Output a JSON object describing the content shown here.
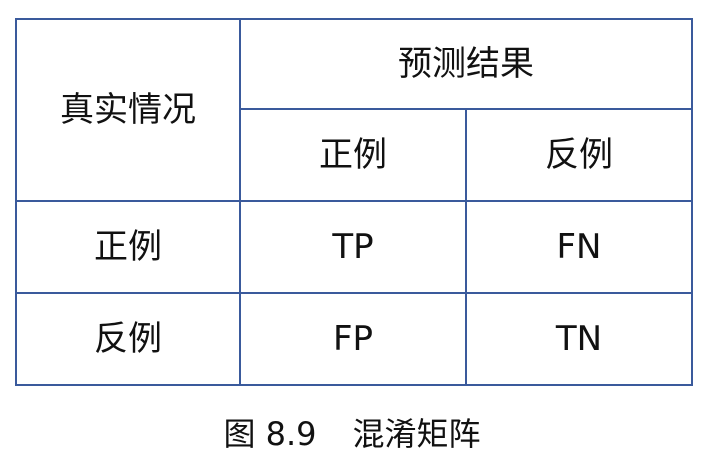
{
  "table": {
    "row_header_title": "真实情况",
    "predicted_header": "预测结果",
    "predicted_columns": [
      "正例",
      "反例"
    ],
    "actual_rows": [
      {
        "label": "正例",
        "cells": [
          "TP",
          "FN"
        ]
      },
      {
        "label": "反例",
        "cells": [
          "FP",
          "TN"
        ]
      }
    ],
    "border_color": "#3a5a9c"
  },
  "caption": {
    "number": "图 8.9",
    "title": "混淆矩阵"
  }
}
